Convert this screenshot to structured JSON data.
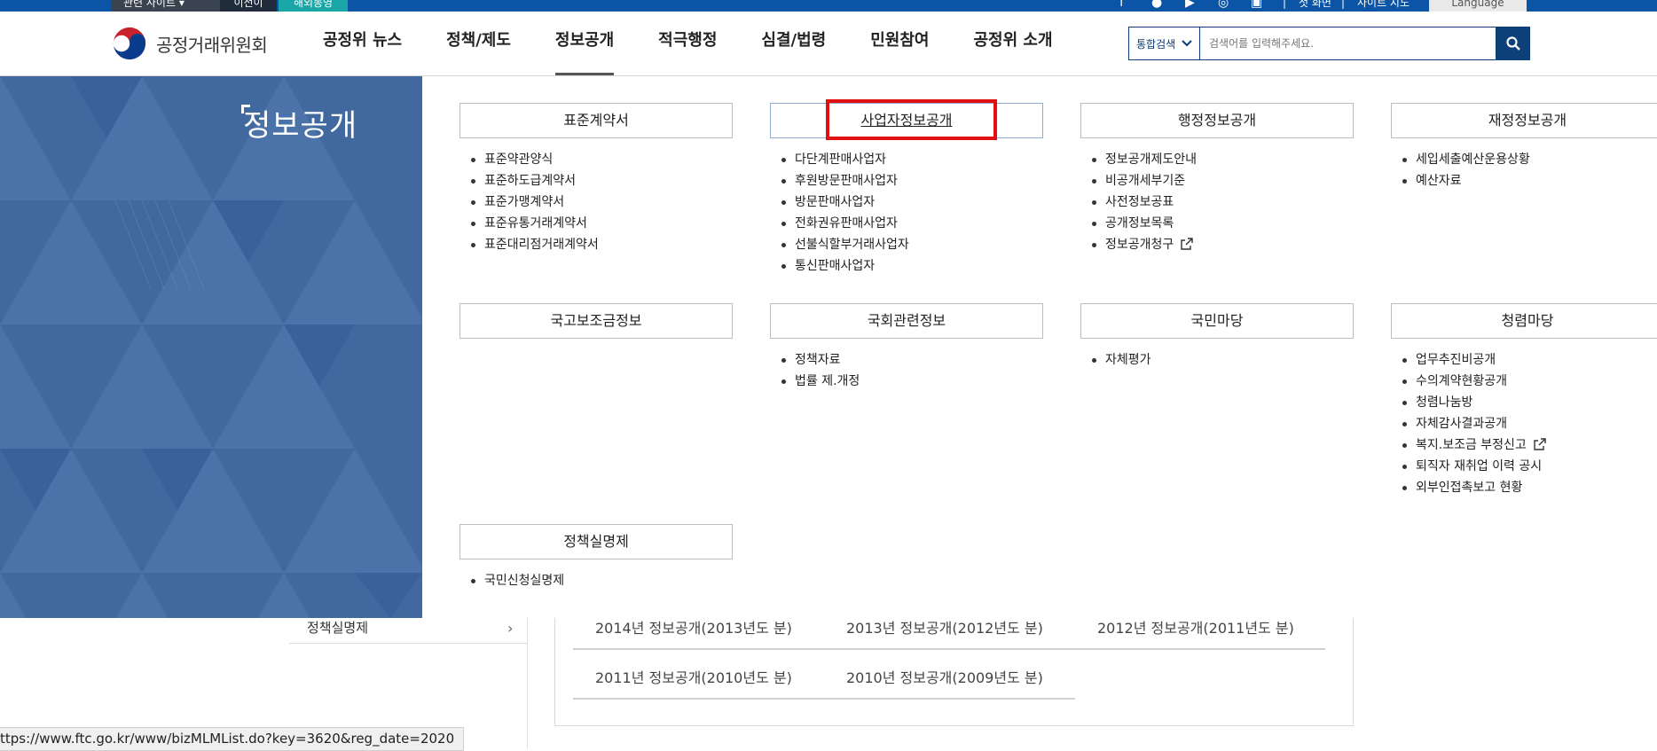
{
  "topbar": {
    "family_sites": "관련 사이트",
    "lang_ko": "이전이",
    "lang_easy": "해외동영",
    "util_home": "첫 화면",
    "util_sitemap": "사이트 지도",
    "language": "Language",
    "sns": [
      "facebook-icon",
      "twitter-icon",
      "youtube-icon",
      "instagram-icon",
      "blog-icon"
    ]
  },
  "header": {
    "logo_text": "공정거래위원회",
    "gnb": [
      {
        "label": "공정위 뉴스"
      },
      {
        "label": "정책/제도"
      },
      {
        "label": "정보공개"
      },
      {
        "label": "적극행정"
      },
      {
        "label": "심결/법령"
      },
      {
        "label": "민원참여"
      },
      {
        "label": "공정위 소개"
      }
    ],
    "active_gnb": "정보공개",
    "search": {
      "select_value": "통합검색",
      "placeholder": "검색어를 입력해주세요."
    }
  },
  "mega_menu": {
    "title": "정보공개",
    "categories": [
      {
        "title": "표준계약서",
        "items": [
          "표준약관양식",
          "표준하도급계약서",
          "표준가맹계약서",
          "표준유통거래계약서",
          "표준대리점거래계약서"
        ]
      },
      {
        "title": "사업자정보공개",
        "items": [
          "다단계판매사업자",
          "후원방문판매사업자",
          "방문판매사업자",
          "전화권유판매사업자",
          "선불식할부거래사업자",
          "통신판매사업자"
        ]
      },
      {
        "title": "행정정보공개",
        "items": [
          "정보공개제도안내",
          "비공개세부기준",
          "사전정보공표",
          "공개정보목록",
          "정보공개청구"
        ]
      },
      {
        "title": "재정정보공개",
        "items": [
          "세입세출예산운용상황",
          "예산자료"
        ]
      },
      {
        "title": "국고보조금정보",
        "items": []
      },
      {
        "title": "국회관련정보",
        "items": [
          "정책자료",
          "법률 제.개정"
        ]
      },
      {
        "title": "국민마당",
        "items": [
          "자체평가"
        ]
      },
      {
        "title": "청렴마당",
        "items": [
          "업무추진비공개",
          "수의계약현황공개",
          "청렴나눔방",
          "자체감사결과공개",
          "복지.보조금 부정신고",
          "퇴직자 재취업 이력 공시",
          "외부인접촉보고 현황"
        ]
      },
      {
        "title": "정책실명제",
        "items": [
          "국민신청실명제"
        ]
      }
    ]
  },
  "page": {
    "lnb_item": "정책실명제",
    "year_links": [
      "2014년 정보공개(2013년도 분)",
      "2013년 정보공개(2012년도 분)",
      "2012년 정보공개(2011년도 분)",
      "2011년 정보공개(2010년도 분)",
      "2010년 정보공개(2009년도 분)"
    ]
  },
  "status_bar": {
    "url": "ttps://www.ftc.go.kr/www/bizMLMList.do?key=3620&reg_date=2020"
  },
  "colors": {
    "topbar": "#0c55a6",
    "side_panel": "#3f6aa4",
    "search_button": "#0d3f78",
    "highlight": "#e01010"
  }
}
